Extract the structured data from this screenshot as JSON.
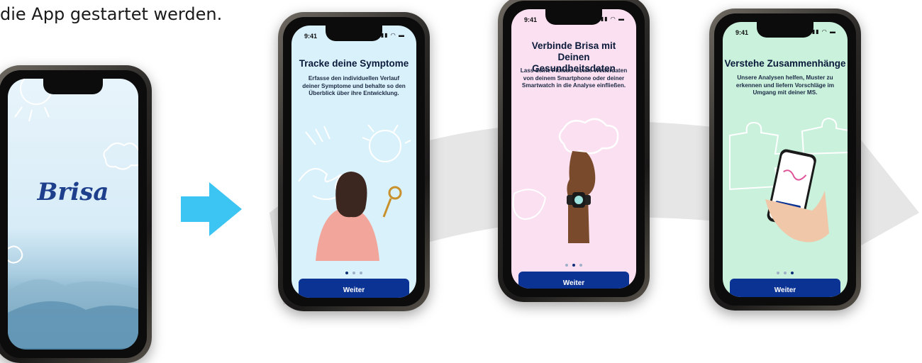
{
  "caption": "die App gestartet werden.",
  "splash": {
    "brand": "Brisa"
  },
  "screens": [
    {
      "time": "9:41",
      "status_icons": "▮▮ ◠ ▬",
      "title": "Tracke deine Symptome",
      "body": "Erfasse den individuellen Verlauf deiner Symptome und behalte so den Überblick über ihre Entwicklung.",
      "button": "Weiter",
      "active_dot": 0,
      "background": "#d9f1fb"
    },
    {
      "time": "9:41",
      "status_icons": "▮▮ ◠ ▬",
      "title": "Verbinde Brisa mit Deinen Gesundheitsdaten",
      "body": "Lass deine Fitness- sowie Wetterdaten von deinem Smartphone oder deiner Smartwatch in die Analyse einfließen.",
      "button": "Weiter",
      "active_dot": 1,
      "background": "#fbe0f1"
    },
    {
      "time": "9:41",
      "status_icons": "▮▮ ◠ ▬",
      "title": "Verstehe Zusammenhänge",
      "body": "Unsere Analysen helfen, Muster zu erkennen und liefern Vorschläge im Umgang mit deiner MS.",
      "button": "Weiter",
      "active_dot": 2,
      "background": "#c9f1dc"
    }
  ],
  "colors": {
    "arrow": "#3cc4f3",
    "button": "#0b3394",
    "swoosh": "#e6e6e6"
  },
  "icons": {
    "arrow": "right-arrow-icon",
    "swoosh": "curved-arrow-icon"
  }
}
